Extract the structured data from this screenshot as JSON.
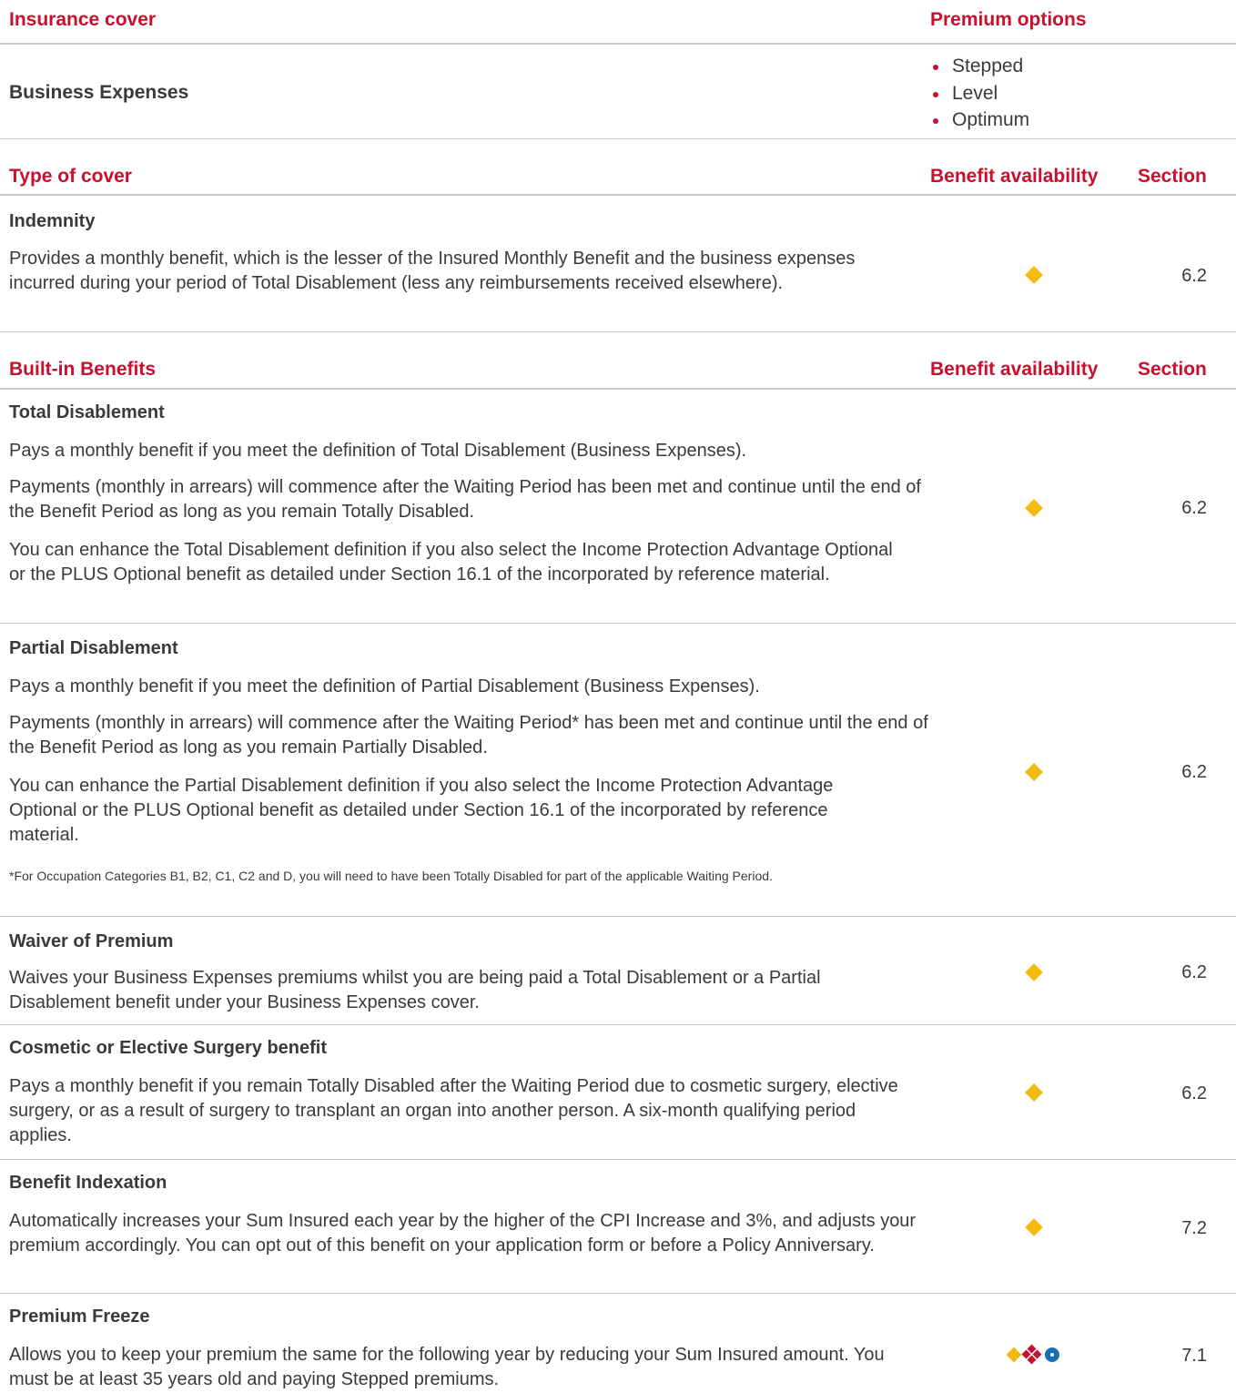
{
  "insurance_table": {
    "col_cover": "Insurance cover",
    "col_premium": "Premium options",
    "cover_name": "Business Expenses",
    "premium_options": [
      "Stepped",
      "Level",
      "Optimum"
    ]
  },
  "type_table": {
    "col_type": "Type of cover",
    "col_availability": "Benefit availability",
    "col_section": "Section",
    "rows": [
      {
        "title": "Indemnity",
        "paragraphs": [
          "Provides a monthly benefit, which is the lesser of the Insured Monthly Benefit and the business expenses incurred during your period of Total Disablement (less any reimbursements received elsewhere)."
        ],
        "section": "6.2"
      }
    ]
  },
  "builtin_table": {
    "col_benefits": "Built-in Benefits",
    "col_availability": "Benefit availability",
    "col_section": "Section",
    "rows": [
      {
        "title": "Total Disablement",
        "paragraphs": [
          "Pays a monthly benefit if you meet the definition of Total Disablement (Business Expenses).",
          "Payments (monthly in arrears) will commence after the Waiting Period has been met and continue until the end of the Benefit Period as long as you remain Totally Disabled.",
          "You can enhance the Total Disablement definition if you also select the Income Protection Advantage Optional or the PLUS Optional benefit as detailed under Section 16.1 of the incorporated by reference material."
        ],
        "section": "6.2"
      },
      {
        "title": "Partial Disablement",
        "paragraphs": [
          "Pays a monthly benefit if you meet the definition of Partial Disablement (Business Expenses).",
          "Payments (monthly in arrears) will commence after the Waiting Period* has been met and continue until the end of the Benefit Period as long as you remain Partially Disabled.",
          "You can enhance the Partial Disablement definition if you also select the Income Protection Advantage Optional or the PLUS Optional benefit as detailed under Section 16.1 of the incorporated by reference material."
        ],
        "footnote": "*For Occupation Categories B1, B2, C1, C2 and D, you will need to have been Totally Disabled for part of the applicable Waiting Period.",
        "section": "6.2"
      },
      {
        "title": "Waiver of Premium",
        "paragraphs": [
          "Waives your Business Expenses premiums whilst you are being paid a Total Disablement or a Partial Disablement benefit under your Business Expenses cover."
        ],
        "section": "6.2"
      },
      {
        "title": "Cosmetic or Elective Surgery benefit",
        "paragraphs": [
          "Pays a monthly benefit if you remain Totally Disabled after the Waiting Period due to cosmetic surgery, elective surgery, or as a result of surgery to transplant an organ into another person. A six-month qualifying period applies."
        ],
        "section": "6.2"
      },
      {
        "title": "Benefit Indexation",
        "paragraphs": [
          "Automatically increases your Sum Insured each year by the higher of the CPI Increase and 3%, and adjusts your premium accordingly. You can opt out of this benefit on your application form or before a Policy Anniversary."
        ],
        "section": "7.2"
      },
      {
        "title": "Premium Freeze",
        "paragraphs": [
          "Allows you to keep your premium the same for the following year by reducing your Sum Insured amount. You must be at least 35 years old and paying Stepped premiums."
        ],
        "section": "7.1"
      }
    ]
  },
  "colors": {
    "heading_red": "#c8102e",
    "diamond_yellow": "#f5b90f",
    "circle_blue": "#1a6fb3",
    "rule_grey": "#c8c8c8"
  },
  "icons": [
    "yellow-diamond-icon",
    "red-diamond-cluster-icon",
    "blue-circle-icon"
  ]
}
